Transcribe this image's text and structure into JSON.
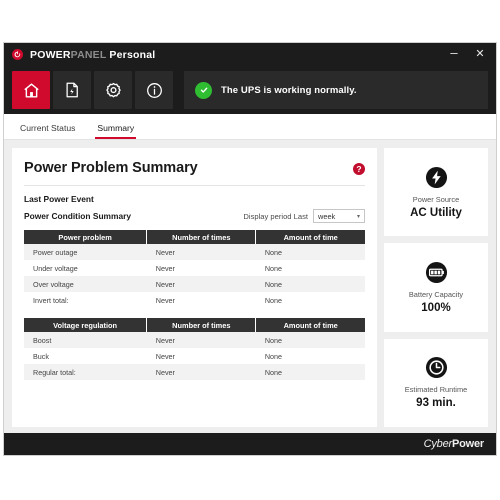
{
  "window": {
    "title_part1": "POWER",
    "title_part2": "PANEL",
    "title_part3": " Personal",
    "logo_icon": "cyberpower-logo-icon",
    "minimize_label": "–",
    "close_label": "✕"
  },
  "toolbar": {
    "buttons": [
      {
        "name": "home",
        "icon": "home-icon",
        "active": true
      },
      {
        "name": "report",
        "icon": "document-bolt-icon",
        "active": false
      },
      {
        "name": "settings",
        "icon": "gear-icon",
        "active": false
      },
      {
        "name": "information",
        "icon": "info-icon",
        "active": false
      }
    ],
    "status": {
      "icon": "check-circle-icon",
      "text": "The UPS is working normally.",
      "color": "#2fbd32"
    }
  },
  "tabs": [
    {
      "label": "Current Status",
      "active": false
    },
    {
      "label": "Summary",
      "active": true
    }
  ],
  "main": {
    "page_title": "Power Problem Summary",
    "help_icon": "help-icon",
    "help_label": "?",
    "last_power_event_label": "Last Power Event",
    "power_condition_label": "Power Condition Summary",
    "period": {
      "label": "Display period Last",
      "value": "week",
      "caret": "▾"
    },
    "tables": [
      {
        "name": "power-problem-table",
        "headers": [
          "Power problem",
          "Number of times",
          "Amount of time"
        ],
        "rows": [
          [
            "Power outage",
            "Never",
            "None"
          ],
          [
            "Under voltage",
            "Never",
            "None"
          ],
          [
            "Over voltage",
            "Never",
            "None"
          ],
          [
            "Invert total:",
            "Never",
            "None"
          ]
        ]
      },
      {
        "name": "voltage-regulation-table",
        "headers": [
          "Voltage regulation",
          "Number of times",
          "Amount of time"
        ],
        "rows": [
          [
            "Boost",
            "Never",
            "None"
          ],
          [
            "Buck",
            "Never",
            "None"
          ],
          [
            "Regular total:",
            "Never",
            "None"
          ]
        ]
      }
    ]
  },
  "side_cards": [
    {
      "icon": "power-bolt-icon",
      "label": "Power Source",
      "value": "AC Utility"
    },
    {
      "icon": "battery-icon",
      "label": "Battery Capacity",
      "value": "100%"
    },
    {
      "icon": "clock-icon",
      "label": "Estimated Runtime",
      "value": "93 min."
    }
  ],
  "footer": {
    "logo_part1": "Cyber",
    "logo_part2": "Power"
  },
  "colors": {
    "accent_red": "#cf0a2c",
    "dark_chrome": "#1c1c1c",
    "status_green": "#2fbd32",
    "table_header": "#333333"
  }
}
